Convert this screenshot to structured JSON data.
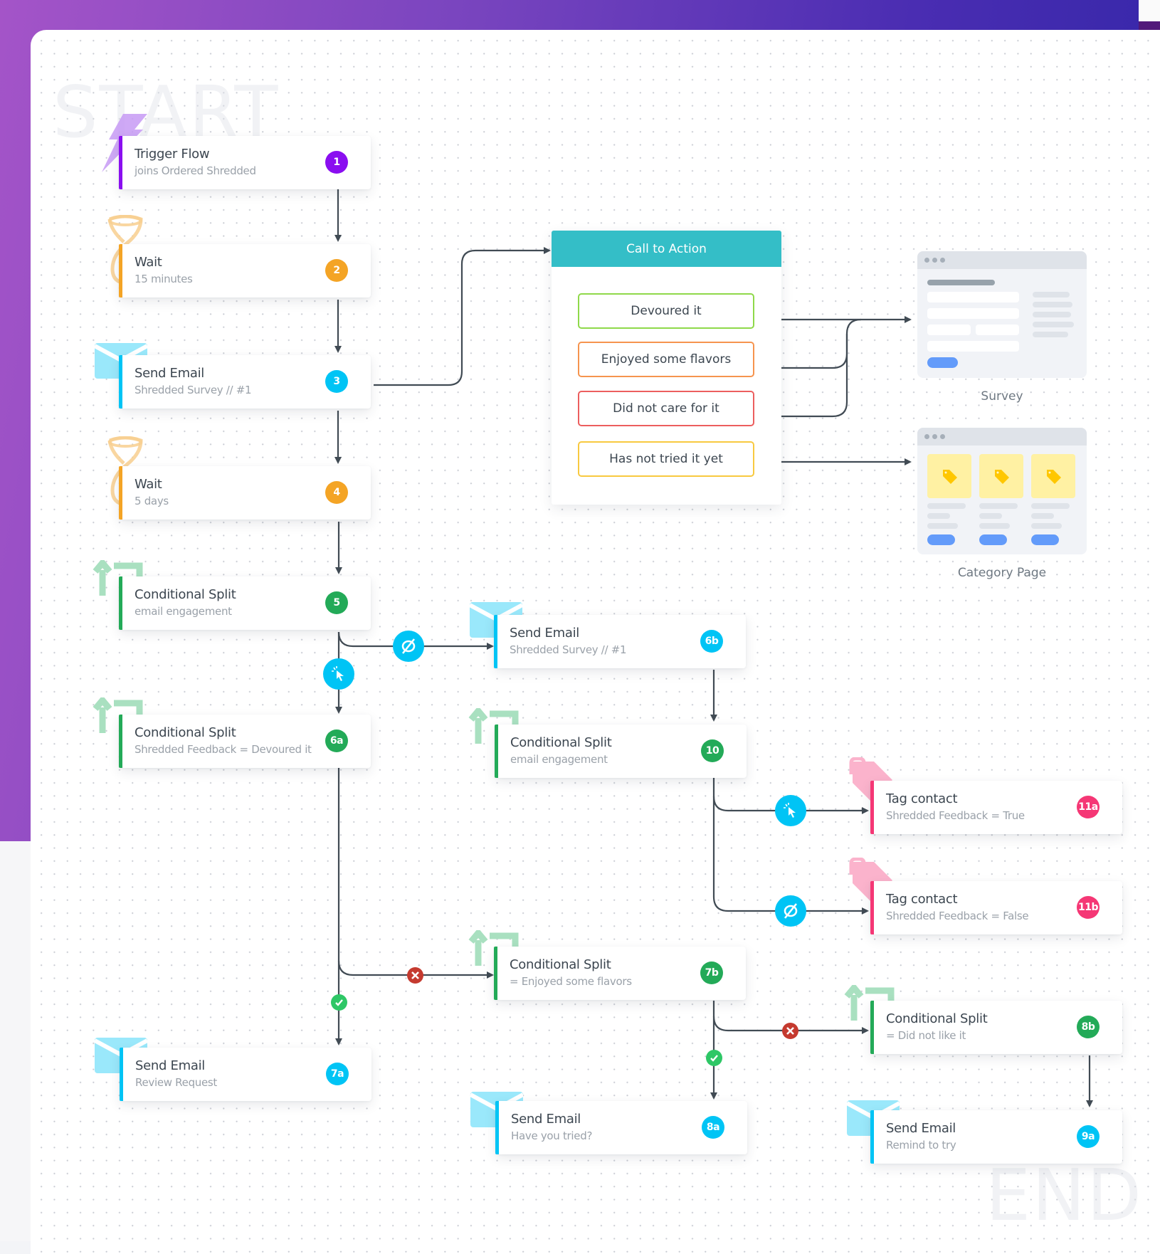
{
  "canvas": {
    "watermark_start": "START",
    "watermark_end": "END"
  },
  "colors": {
    "trigger": "#8a0ef0",
    "wait": "#f4a425",
    "email": "#00c4f5",
    "split": "#23aa58",
    "tag": "#f53775",
    "cta_header": "#34bec7",
    "connector": "#414b54",
    "no_icon": "#c53a2f",
    "yes_icon": "#2ec766"
  },
  "nodes": [
    {
      "id": "1",
      "type": "trigger",
      "title": "Trigger Flow",
      "subtitle": "joins Ordered Shredded",
      "badge": "1"
    },
    {
      "id": "2",
      "type": "wait",
      "title": "Wait",
      "subtitle": "15 minutes",
      "badge": "2"
    },
    {
      "id": "3",
      "type": "email",
      "title": "Send Email",
      "subtitle": "Shredded Survey // #1",
      "badge": "3"
    },
    {
      "id": "4",
      "type": "wait",
      "title": "Wait",
      "subtitle": "5 days",
      "badge": "4"
    },
    {
      "id": "5",
      "type": "split",
      "title": "Conditional Split",
      "subtitle": "email engagement",
      "badge": "5"
    },
    {
      "id": "6a",
      "type": "split",
      "title": "Conditional Split",
      "subtitle": "Shredded Feedback = Devoured it",
      "badge": "6a"
    },
    {
      "id": "6b",
      "type": "email",
      "title": "Send Email",
      "subtitle": "Shredded Survey // #1",
      "badge": "6b"
    },
    {
      "id": "10",
      "type": "split",
      "title": "Conditional Split",
      "subtitle": "email engagement",
      "badge": "10"
    },
    {
      "id": "11a",
      "type": "tag",
      "title": "Tag contact",
      "subtitle": "Shredded Feedback = True",
      "badge": "11a"
    },
    {
      "id": "11b",
      "type": "tag",
      "title": "Tag contact",
      "subtitle": "Shredded Feedback = False",
      "badge": "11b"
    },
    {
      "id": "7b",
      "type": "split",
      "title": "Conditional Split",
      "subtitle": "= Enjoyed some flavors",
      "badge": "7b"
    },
    {
      "id": "7a",
      "type": "email",
      "title": "Send Email",
      "subtitle": "Review Request",
      "badge": "7a"
    },
    {
      "id": "8b",
      "type": "split",
      "title": "Conditional Split",
      "subtitle": "= Did not like it",
      "badge": "8b"
    },
    {
      "id": "8a",
      "type": "email",
      "title": "Send Email",
      "subtitle": "Have you tried?",
      "badge": "8a"
    },
    {
      "id": "9a",
      "type": "email",
      "title": "Send Email",
      "subtitle": "Remind to try",
      "badge": "9a"
    }
  ],
  "call_to_action": {
    "title": "Call to Action",
    "options": [
      {
        "label": "Devoured it",
        "color": "#8fd94a"
      },
      {
        "label": "Enjoyed some flavors",
        "color": "#f6944e"
      },
      {
        "label": "Did not care for it",
        "color": "#ec5e5e"
      },
      {
        "label": "Has not tried it yet",
        "color": "#f8c940"
      }
    ]
  },
  "destinations": {
    "survey_label": "Survey",
    "category_label": "Category Page"
  }
}
